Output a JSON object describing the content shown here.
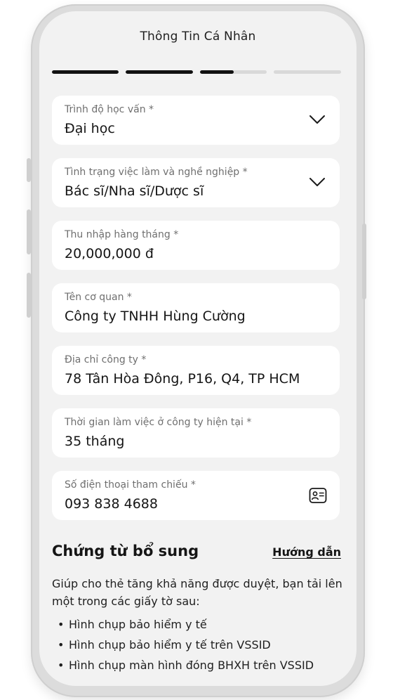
{
  "header": {
    "title": "Thông Tin Cá Nhân"
  },
  "progress": {
    "total_steps": 4,
    "steps_fill": [
      1,
      1,
      0.5,
      0
    ]
  },
  "form": {
    "fields": [
      {
        "label": "Trình độ học vấn *",
        "value": "Đại học",
        "control": "dropdown"
      },
      {
        "label": "Tình trạng việc làm và nghề nghiệp *",
        "value": "Bác sĩ/Nha sĩ/Dược sĩ",
        "control": "dropdown"
      },
      {
        "label": "Thu nhập hàng tháng *",
        "value": "20,000,000 đ",
        "control": "text"
      },
      {
        "label": "Tên cơ quan *",
        "value": "Công ty TNHH Hùng Cường",
        "control": "text"
      },
      {
        "label": "Địa chỉ công ty *",
        "value": "78 Tân Hòa Đông, P16, Q4, TP HCM",
        "control": "text"
      },
      {
        "label": "Thời gian làm việc ở công ty hiện tại *",
        "value": "35 tháng",
        "control": "text"
      },
      {
        "label": "Số điện thoại tham chiếu *",
        "value": "093 838 4688",
        "control": "contact-picker"
      }
    ]
  },
  "supplement": {
    "title": "Chứng từ bổ sung",
    "guide_link": "Hướng dẫn",
    "description": "Giúp cho thẻ tăng khả năng được duyệt, bạn tải lên một trong các giấy tờ sau:",
    "documents": [
      "Hình chụp bảo hiểm y tế",
      "Hình chụp bảo hiểm y tế trên VSSID",
      "Hình chụp màn hình đóng BHXH trên VSSID"
    ]
  },
  "icons": {
    "dropdown": "chevron-down-icon",
    "contact": "contact-card-icon",
    "bullet": "•"
  },
  "colors": {
    "background": "#f2f2f2",
    "card": "#ffffff",
    "text": "#151515",
    "label": "#6f6f6f",
    "progress_active": "#111111",
    "progress_inactive": "#d9d9d9"
  }
}
